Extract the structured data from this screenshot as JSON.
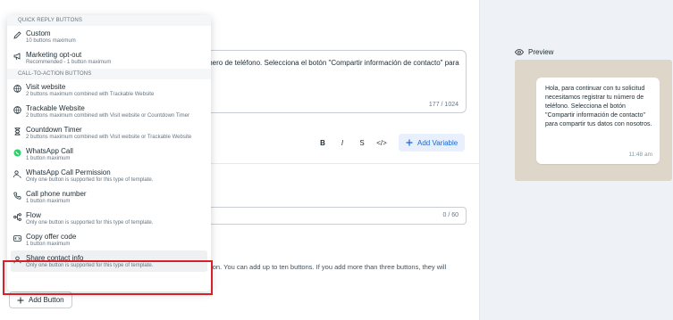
{
  "editor": {
    "body_text": "mero de teléfono. Selecciona el botón \"Compartir información de contacto\" para",
    "body_counter": "177 / 1024",
    "format": {
      "bold": "B",
      "italic": "I",
      "strike": "S",
      "code": "</>"
    },
    "add_variable_label": "Add Variable",
    "second_counter": "0 / 60",
    "buttons_desc_line1": "tion. You can add up to ten buttons. If you add more than three buttons, they will",
    "buttons_desc_line2": "ll",
    "add_button_label": "Add Button"
  },
  "menu": {
    "quick_reply_header": "QUICK REPLY BUTTONS",
    "cta_header": "CALL-TO-ACTION BUTTONS",
    "quick_reply_items": [
      {
        "title": "Custom",
        "sub": "10 buttons maximum",
        "icon": "pencil-icon"
      },
      {
        "title": "Marketing opt-out",
        "sub": "Recommended - 1 button maximum",
        "icon": "megaphone-icon"
      }
    ],
    "cta_items": [
      {
        "title": "Visit website",
        "sub": "2 buttons maximum combined with Trackable Website",
        "icon": "globe-icon"
      },
      {
        "title": "Trackable Website",
        "sub": "2 buttons maximum combined with Visit website or Countdown Timer",
        "icon": "globe-icon"
      },
      {
        "title": "Countdown Timer",
        "sub": "2 buttons maximum combined with Visit website or Trackable Website",
        "icon": "hourglass-icon"
      },
      {
        "title": "WhatsApp Call",
        "sub": "1 button maximum",
        "icon": "whatsapp-icon"
      },
      {
        "title": "WhatsApp Call Permission",
        "sub": "Only one button is supported for this type of template.",
        "icon": "user-phone-icon"
      },
      {
        "title": "Call phone number",
        "sub": "1 button maximum",
        "icon": "phone-icon"
      },
      {
        "title": "Flow",
        "sub": "Only one button is supported for this type of template.",
        "icon": "flow-icon"
      },
      {
        "title": "Copy offer code",
        "sub": "1 button maximum",
        "icon": "code-icon"
      },
      {
        "title": "Share contact info",
        "sub": "Only one button is supported for this type of template.",
        "icon": "contact-icon"
      }
    ]
  },
  "preview": {
    "label": "Preview",
    "message": "Hola, para continuar con tu solicitud necesitamos registrar tu número de teléfono. Selecciona el botón \"Compartir información de contacto\" para compartir tus datos con nosotros.",
    "time": "11:48 am"
  },
  "colors": {
    "accent": "#1a66d6",
    "highlight": "#d6202b",
    "whatsapp": "#25d366"
  }
}
